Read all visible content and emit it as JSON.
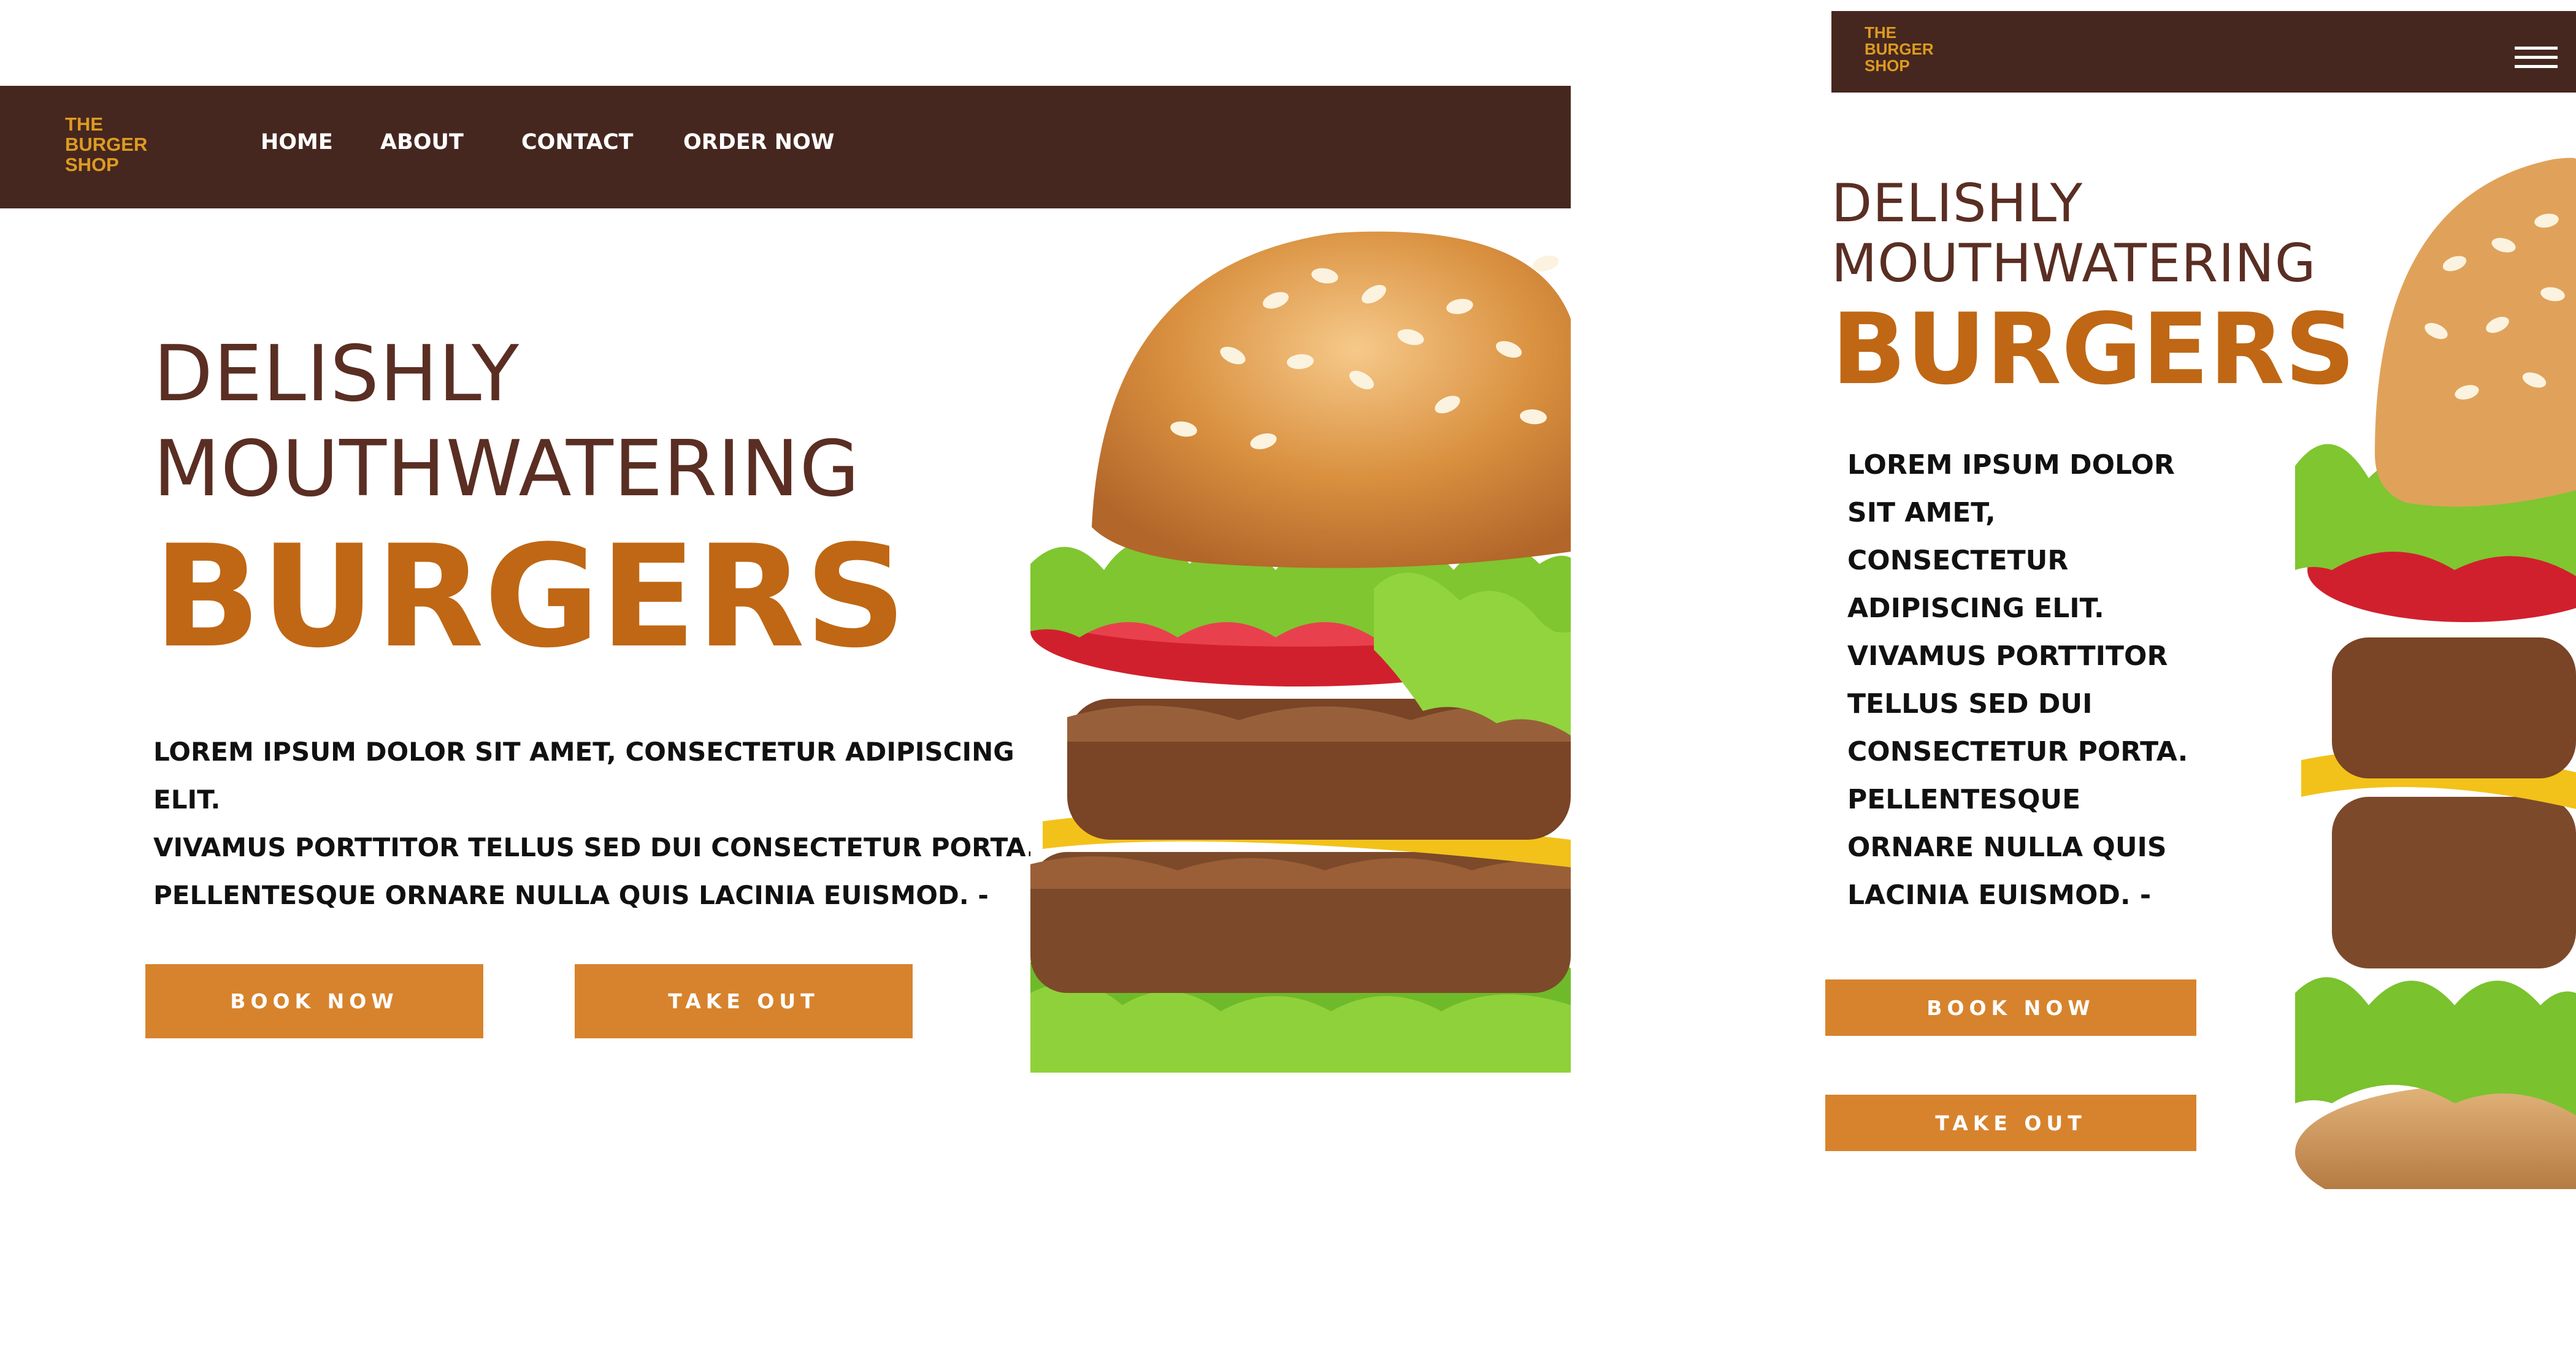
{
  "brand": {
    "line1": "THE",
    "line2": "BURGER",
    "line3": "SHOP",
    "color": "#dd9b22"
  },
  "nav": {
    "home": "HOME",
    "about": "ABOUT",
    "contact": "CONTACT",
    "order": "ORDER NOW"
  },
  "hero": {
    "line1": "DELISHLY",
    "line2": "MOUTHWATERING",
    "headline": "BURGERS",
    "desktop_para": [
      "LOREM IPSUM DOLOR SIT AMET, CONSECTETUR ADIPISCING ELIT.",
      "VIVAMUS PORTTITOR TELLUS SED DUI CONSECTETUR PORTA.",
      "PELLENTESQUE ORNARE NULLA QUIS LACINIA EUISMOD. -"
    ],
    "mobile_para": [
      "LOREM IPSUM DOLOR",
      "SIT AMET,",
      "CONSECTETUR",
      "ADIPISCING ELIT.",
      "VIVAMUS PORTTITOR",
      "TELLUS SED DUI",
      "CONSECTETUR PORTA.",
      "PELLENTESQUE",
      "ORNARE NULLA QUIS",
      "LACINIA EUISMOD. -"
    ]
  },
  "buttons": {
    "book": "BOOK NOW",
    "takeout": "TAKE OUT"
  },
  "icons": {
    "menu": "hamburger-menu-icon",
    "hero_image": "burger-image"
  },
  "colors": {
    "nav_bg": "#46271f",
    "heading": "#5a2e23",
    "headline": "#bf6714",
    "button": "#d7832d"
  }
}
